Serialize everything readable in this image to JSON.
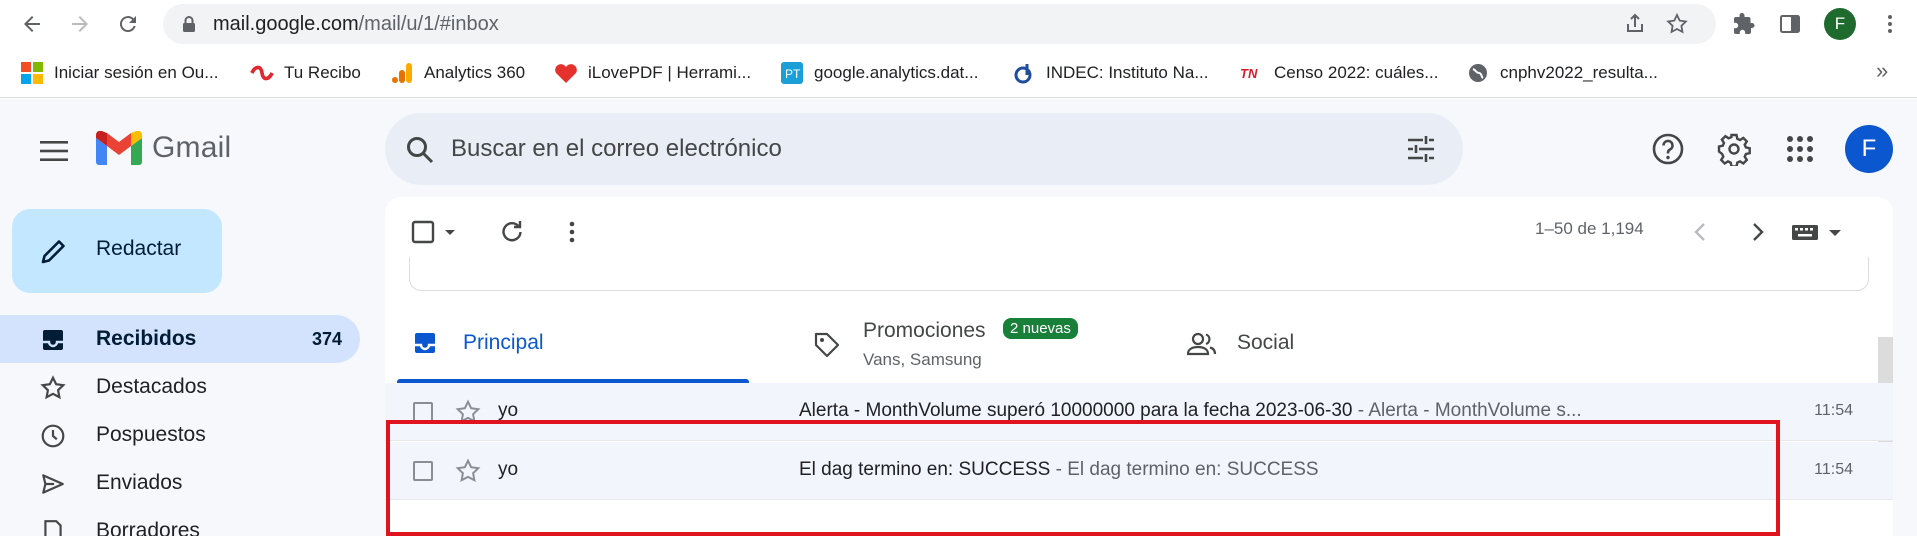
{
  "browser": {
    "url_host": "mail.google.com",
    "url_path": "/mail/u/1/#inbox",
    "profile_initial": "F",
    "bookmarks": [
      {
        "label": "Iniciar sesión en Ou...",
        "icon": "microsoft-icon"
      },
      {
        "label": "Tu Recibo",
        "icon": "tu-recibo-icon"
      },
      {
        "label": "Analytics 360",
        "icon": "analytics-icon"
      },
      {
        "label": "iLovePDF | Herrami...",
        "icon": "ilovepdf-icon"
      },
      {
        "label": "google.analytics.dat...",
        "icon": "google-analytics-data-icon"
      },
      {
        "label": "INDEC: Instituto Na...",
        "icon": "indec-icon"
      },
      {
        "label": "Censo 2022: cuáles...",
        "icon": "tn-icon"
      },
      {
        "label": "cnphv2022_resulta...",
        "icon": "globe-icon"
      }
    ],
    "bookmarks_more": "»"
  },
  "gmail": {
    "logo_text": "Gmail",
    "search_placeholder": "Buscar en el correo electrónico",
    "account_initial": "F",
    "compose_label": "Redactar",
    "nav": [
      {
        "label": "Recibidos",
        "count": "374",
        "icon": "inbox-icon",
        "active": true
      },
      {
        "label": "Destacados",
        "count": "",
        "icon": "star-icon",
        "active": false
      },
      {
        "label": "Pospuestos",
        "count": "",
        "icon": "clock-icon",
        "active": false
      },
      {
        "label": "Enviados",
        "count": "",
        "icon": "send-icon",
        "active": false
      },
      {
        "label": "Borradores",
        "count": "",
        "icon": "draft-icon",
        "active": false
      }
    ],
    "pagination": "1–50 de 1,194",
    "tabs": [
      {
        "label": "Principal",
        "icon": "inbox-tab-icon",
        "active": true
      },
      {
        "label": "Promociones",
        "badge": "2 nuevas",
        "sub": "Vans, Samsung",
        "icon": "tag-icon"
      },
      {
        "label": "Social",
        "icon": "people-icon"
      }
    ],
    "emails": [
      {
        "sender": "yo",
        "subject": "Alerta - MonthVolume superó 10000000 para la fecha 2023-06-30",
        "snippet": " - Alerta - MonthVolume s...",
        "time": "11:54"
      },
      {
        "sender": "yo",
        "subject": "El dag termino en: SUCCESS",
        "snippet": " - El dag termino en: SUCCESS",
        "time": "11:54"
      }
    ]
  },
  "colors": {
    "accent": "#0b57d0",
    "compose_bg": "#c2e7ff",
    "active_nav_bg": "#d3e3fd",
    "badge_green": "#188038",
    "highlight_red": "#e0141e"
  }
}
